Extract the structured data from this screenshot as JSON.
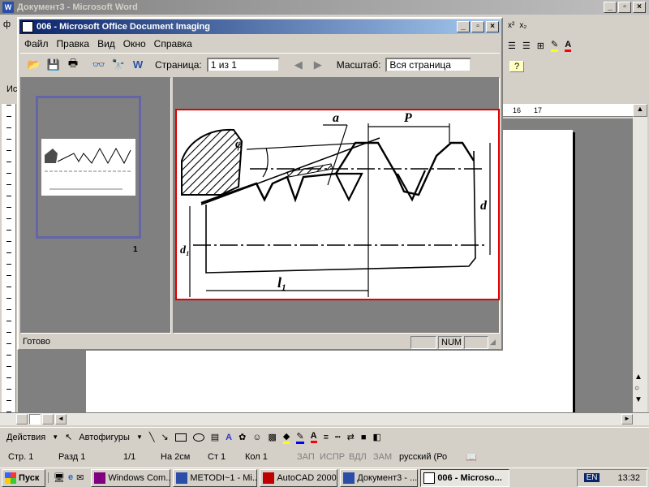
{
  "word": {
    "title": "Документ3 - Microsoft Word",
    "menu_fragment": "ф",
    "side_label": "Ис",
    "drawing_toolbar": {
      "actions": "Действия",
      "autoshapes": "Автофигуры"
    },
    "status": {
      "page": "Стр. 1",
      "section": "Разд 1",
      "pages": "1/1",
      "at": "На 2см",
      "line": "Ст 1",
      "col": "Кол 1",
      "rec": "ЗАП",
      "trk": "ИСПР",
      "ext": "ВДЛ",
      "ovr": "ЗАМ",
      "lang": "русский (Ро"
    },
    "ruler_marks": [
      "16",
      "17"
    ]
  },
  "imaging": {
    "title": "006 - Microsoft Office Document Imaging",
    "menu": [
      "Файл",
      "Правка",
      "Вид",
      "Окно",
      "Справка"
    ],
    "page_label": "Страница:",
    "page_value": "1 из 1",
    "zoom_label": "Масштаб:",
    "zoom_value": "Вся страница",
    "thumbnail_number": "1",
    "status_ready": "Готово",
    "status_num": "NUM",
    "drawing_labels": {
      "a": "a",
      "p": "P",
      "phi": "φ",
      "d": "d",
      "d1": "d₁",
      "l1": "l₁"
    }
  },
  "taskbar": {
    "start": "Пуск",
    "buttons": [
      "Windows Com...",
      "METODI~1 - Mi...",
      "AutoCAD 2000",
      "Документ3 - ...",
      "006 - Microso..."
    ],
    "lang": "EN",
    "clock": "13:32"
  },
  "colors": {
    "title_active": "#0a246a",
    "title_gradient_end": "#a6caf0",
    "workspace": "#808080",
    "frame": "#e00000"
  }
}
